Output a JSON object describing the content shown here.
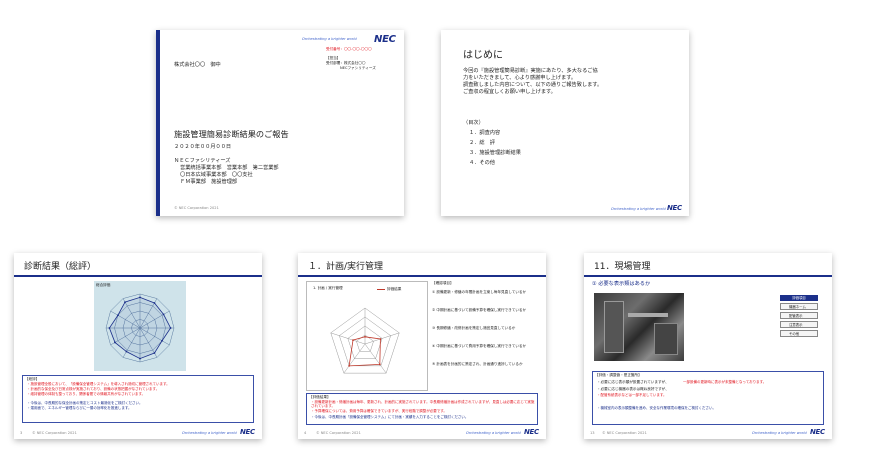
{
  "brand": {
    "logo": "NEC",
    "tagline": "Orchestrating a brighter world",
    "copyright": "© NEC Corporation 2021"
  },
  "slide1": {
    "recipient": "株式会社〇〇　御中",
    "report_no": "受付番号：〇〇-〇〇-〇〇〇",
    "office_label": "【担当】",
    "office_value": "受付部署：株式会社〇〇",
    "office_company": "NECファシリティーズ",
    "title": "施設管理簡易診断結果のご報告",
    "date": "２０２０年００月００日",
    "company": "ＮＥＣファシリティーズ",
    "lines": [
      "営業統括事業本部　営業本部　第二営業部",
      "〇日本広域事業本部　〇〇支社",
      "ＦＭ事業部　施設管理部"
    ]
  },
  "slide2": {
    "title": "はじめに",
    "body": [
      "今回の『施設管理簡易診断』実施にあたり、多大なるご協",
      "力をいただきまして、心より感謝申し上げます。",
      "調査致しました内容について、以下の通りご報告致します。",
      "ご査収の程宜しくお願い申し上げます。"
    ],
    "toc_title": "（目次）",
    "toc": [
      "１．調査内容",
      "２．総　評",
      "３．施設管理診断結果",
      "４．その他"
    ]
  },
  "slide3": {
    "title": "診断結果（総評）",
    "chart_label": "総合評価",
    "summary_label": "【総評】",
    "summary_red": [
      "・施設管理全般において、「設備保全管理システム」を導入され適切に管理されています。",
      "・計画的な保全及び日常点検が実施されており、設備の状態把握がなされています。",
      "・維持管理の体制も整っており、関係者間での情報共有がなされています。"
    ],
    "summary_blue": [
      "・今後は、中長期的な保全計画の策定とコスト最適化をご検討ください。",
      "・運用面で、エネルギー管理ならびに一層の効率化を推進します。"
    ],
    "page": "3"
  },
  "slide4": {
    "title": "１．計画/実行管理",
    "chart_title": "1. 計画 / 実行管理",
    "legend": "評価結果",
    "checks_title": "【確認項目】",
    "checks": [
      "① 設備更新・修繕の年間計画を立案し毎年見直しているか",
      "② 中期計画に基づいて設備予算を確保し実行できているか",
      "③ 長期修繕・改修計画を策定し適宜見直しているか",
      "④ 中期計画に基づいて費用予算を確保し実行できているか",
      "⑤ 計画表を計画的に策定され、計画通り進捗しているか"
    ],
    "evaluation_label": "【評価結果】",
    "evaluation_red": [
      "・設備更新計画・修繕計画は毎年、更新され、計画的に実施されています。中長期修繕計画は作成されていますが、見直しは必要に応じて実施されています。",
      "・予算確保については、費用予算は確保できていますが、実行段階で調整が必要です。"
    ],
    "evaluation_blue": [
      "・今後は、中長期計画「設備保全管理システム」にて計画・実績を入力することをご検討ください。"
    ],
    "page": "4"
  },
  "slide5": {
    "title": "11．現場管理",
    "question": "① 必要な表示類はあるか",
    "menu_title": "評価項目",
    "menu": [
      "機器ネーム",
      "配管表示",
      "注意表示",
      "その他"
    ],
    "evaluation_label": "【評価・調整値・是正箇所】",
    "evaluation_black": [
      "・必要に応じ表示類が設置されていますが、",
      "・必要に応じ機器の表示は概ね良好ですが、"
    ],
    "evaluation_red": [
      "一部設備の更新時に表示が未整備となっております。",
      "・配管系統表示などは一部不足しています。"
    ],
    "evaluation_blue": [
      "・機械室内の表示類整備を進め、安全な作業環境の確保をご検討ください。"
    ],
    "page": "13"
  },
  "colors": {
    "nec_blue": "#1b2f8a",
    "accent_red": "#e0141e",
    "chart_bg": "#cfe3ea"
  },
  "chart_data": [
    {
      "type": "radar",
      "axes": [
        "",
        "",
        "",
        "",
        "",
        "",
        "",
        "",
        "",
        "",
        "",
        ""
      ],
      "series": [
        {
          "name": "",
          "values": [
            0.9,
            0.85,
            0.8,
            0.9,
            0.75,
            0.85,
            0.9,
            0.8,
            0.85,
            0.9,
            0.75,
            0.88
          ]
        }
      ],
      "rlim": [
        0,
        1
      ]
    },
    {
      "type": "radar",
      "axes": [
        "",
        "",
        "",
        "",
        ""
      ],
      "series": [
        {
          "name": "評価結果",
          "values": [
            0.2,
            0.45,
            0.7,
            0.75,
            0.35
          ]
        }
      ],
      "rlim": [
        0,
        1
      ]
    }
  ]
}
